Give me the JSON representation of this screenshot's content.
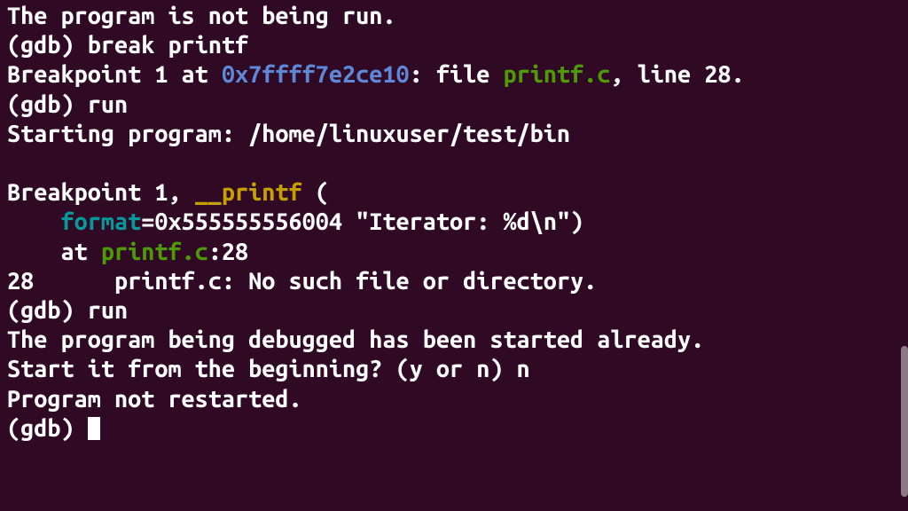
{
  "l1": "The program is not being run.",
  "l2a": "(gdb) ",
  "l2b": "break printf",
  "l3a": "Breakpoint 1 at ",
  "l3b": "0x7ffff7e2ce10",
  "l3c": ": file ",
  "l3d": "printf.c",
  "l3e": ", line 28.",
  "l4a": "(gdb) ",
  "l4b": "run",
  "l5": "Starting program: /home/linuxuser/test/bin ",
  "blank": " ",
  "l7a": "Breakpoint 1, ",
  "l7b": "__printf",
  "l7c": " (",
  "l8a": "    ",
  "l8b": "format",
  "l8c": "=0x555555556004 \"Iterator: %d\\n\")",
  "l9a": "    at ",
  "l9b": "printf.c",
  "l9c": ":28",
  "l10": "28      printf.c: No such file or directory.",
  "l11a": "(gdb) ",
  "l11b": "run",
  "l12": "The program being debugged has been started already.",
  "l13": "Start it from the beginning? (y or n) n",
  "l14": "Program not restarted.",
  "l15": "(gdb) "
}
